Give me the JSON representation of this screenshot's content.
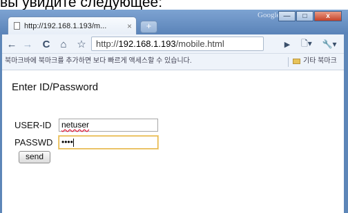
{
  "caption": "вы увидите следующее:",
  "window": {
    "title_brand": "Google",
    "minimize": "—",
    "maximize": "□",
    "close": "x"
  },
  "tab": {
    "title": "http://192.168.1.193/m...",
    "close": "×",
    "new_tab": "+"
  },
  "toolbar": {
    "back": "←",
    "forward": "→",
    "reload": "C",
    "home": "⌂",
    "star": "☆",
    "url_scheme": "http://",
    "url_host": "192.168.1.193",
    "url_path": "/mobile.html",
    "go": "▶",
    "page_menu": "🗋▾",
    "tools_menu": "🔧▾"
  },
  "bookmarks": {
    "message": "북마크바에 북마크를 추가하면 보다 빠르게 액세스할 수 있습니다.",
    "other": "기타 북마크"
  },
  "form": {
    "heading": "Enter ID/Password",
    "user_label": "USER-ID",
    "user_value": "netuser",
    "pass_label": "PASSWD",
    "pass_value": "••••",
    "send": "send"
  },
  "colors": {
    "frame": "#5d86b8",
    "focus_border": "#e5b343"
  }
}
